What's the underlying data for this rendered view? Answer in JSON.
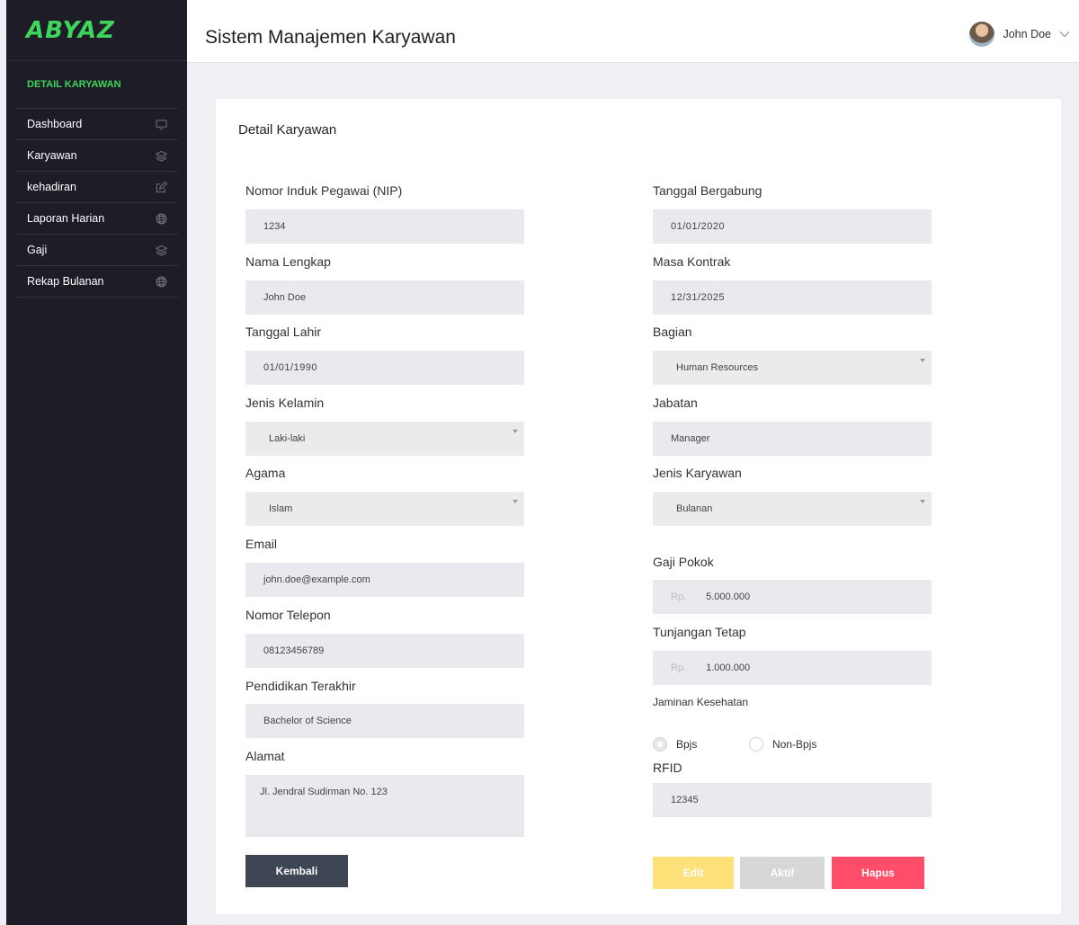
{
  "brand": {
    "logo_text": "ABYAZ"
  },
  "sidebar": {
    "section": "DETAIL KARYAWAN",
    "items": [
      {
        "label": "Dashboard",
        "icon": "monitor-icon"
      },
      {
        "label": "Karyawan",
        "icon": "layers-icon"
      },
      {
        "label": "kehadiran",
        "icon": "edit-icon"
      },
      {
        "label": "Laporan Harian",
        "icon": "globe-icon"
      },
      {
        "label": "Gaji",
        "icon": "layers-icon"
      },
      {
        "label": "Rekap Bulanan",
        "icon": "globe-icon"
      }
    ]
  },
  "header": {
    "title": "Sistem Manajemen Karyawan",
    "user_name": "John Doe"
  },
  "card": {
    "title": "Detail Karyawan"
  },
  "form": {
    "nip": {
      "label": "Nomor Induk Pegawai (NIP)",
      "value": "1234"
    },
    "nama": {
      "label": "Nama Lengkap",
      "value": "John Doe"
    },
    "tanggal_lahir": {
      "label": "Tanggal Lahir",
      "value": "01/01/1990"
    },
    "jenis_kelamin": {
      "label": "Jenis Kelamin",
      "value": "Laki-laki"
    },
    "agama": {
      "label": "Agama",
      "value": "Islam"
    },
    "email": {
      "label": "Email",
      "value": "john.doe@example.com"
    },
    "telepon": {
      "label": "Nomor Telepon",
      "value": "08123456789"
    },
    "pendidikan": {
      "label": "Pendidikan Terakhir",
      "value": "Bachelor of Science"
    },
    "alamat": {
      "label": "Alamat",
      "value": "Jl. Jendral Sudirman No. 123"
    },
    "tanggal_bergabung": {
      "label": "Tanggal Bergabung",
      "value": "01/01/2020"
    },
    "masa_kontrak": {
      "label": "Masa Kontrak",
      "value": "12/31/2025"
    },
    "bagian": {
      "label": "Bagian",
      "value": "Human Resources"
    },
    "jabatan": {
      "label": "Jabatan",
      "value": "Manager"
    },
    "jenis_karyawan": {
      "label": "Jenis Karyawan",
      "value": "Bulanan"
    },
    "gaji_pokok": {
      "label": "Gaji Pokok",
      "prefix": "Rp.",
      "value": "5.000.000"
    },
    "tunjangan": {
      "label": "Tunjangan Tetap",
      "prefix": "Rp.",
      "value": "1.000.000"
    },
    "jaminan": {
      "label": "Jaminan Kesehatan",
      "options": [
        "Bpjs",
        "Non-Bpjs"
      ],
      "selected": "Bpjs"
    },
    "rfid": {
      "label": "RFID",
      "value": "12345"
    }
  },
  "buttons": {
    "kembali": "Kembali",
    "edit": "Edit",
    "aktif": "Aktif",
    "hapus": "Hapus"
  },
  "colors": {
    "sidebar_bg": "#1d1c27",
    "accent_green": "#3ed65a",
    "btn_kembali": "#3e4653",
    "btn_edit": "#ffe17a",
    "btn_aktif": "#d7d7d9",
    "btn_hapus": "#ff4d6a"
  }
}
